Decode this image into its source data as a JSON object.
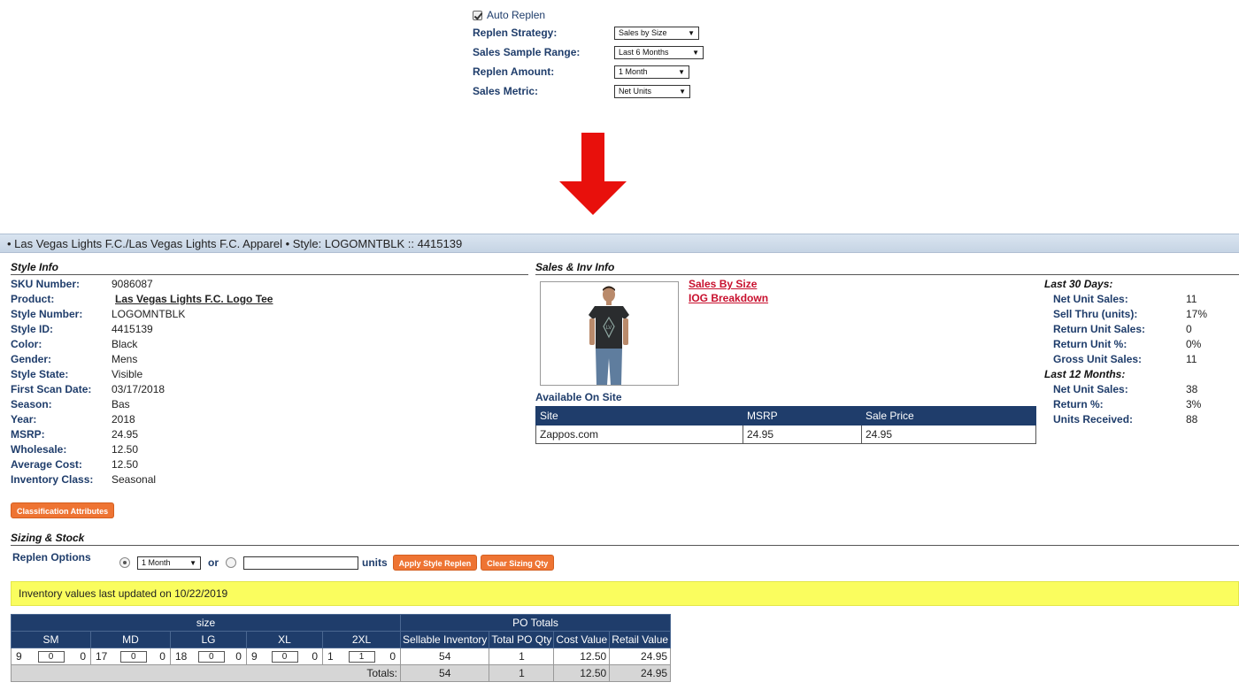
{
  "settings": {
    "auto_replen_label": "Auto Replen",
    "rows": [
      {
        "label": "Replen Strategy:",
        "value": "Sales by Size"
      },
      {
        "label": "Sales Sample Range:",
        "value": "Last 6 Months"
      },
      {
        "label": "Replen Amount:",
        "value": "1 Month"
      },
      {
        "label": "Sales Metric:",
        "value": "Net Units"
      }
    ]
  },
  "header": {
    "title": "• Las Vegas Lights F.C./Las Vegas Lights F.C. Apparel • Style: LOGOMNTBLK :: 4415139"
  },
  "style_info": {
    "title": "Style Info",
    "rows": [
      {
        "label": "SKU Number:",
        "value": "9086087"
      },
      {
        "label": "Product:",
        "value": "Las Vegas Lights F.C. Logo Tee"
      },
      {
        "label": "Style Number:",
        "value": "LOGOMNTBLK"
      },
      {
        "label": "Style ID:",
        "value": "4415139"
      },
      {
        "label": "Color:",
        "value": "Black"
      },
      {
        "label": "Gender:",
        "value": "Mens"
      },
      {
        "label": "Style State:",
        "value": "Visible"
      },
      {
        "label": "First Scan Date:",
        "value": "03/17/2018"
      },
      {
        "label": "Season:",
        "value": "Bas"
      },
      {
        "label": "Year:",
        "value": "2018"
      },
      {
        "label": "MSRP:",
        "value": "24.95"
      },
      {
        "label": "Wholesale:",
        "value": "12.50"
      },
      {
        "label": "Average Cost:",
        "value": "12.50"
      },
      {
        "label": "Inventory Class:",
        "value": "Seasonal"
      }
    ],
    "classification_button": "Classification Attributes"
  },
  "sales_info": {
    "title": "Sales & Inv Info",
    "links": [
      "Sales By Size",
      "IOG Breakdown"
    ],
    "available_label": "Available On Site",
    "site_table": {
      "headers": [
        "Site",
        "MSRP",
        "Sale Price"
      ],
      "rows": [
        [
          "Zappos.com",
          "24.95",
          "24.95"
        ]
      ]
    },
    "last30_label": "Last 30 Days:",
    "last30": [
      {
        "label": "Net Unit Sales:",
        "value": "11"
      },
      {
        "label": "Sell Thru (units):",
        "value": "17%"
      },
      {
        "label": "Return Unit Sales:",
        "value": "0"
      },
      {
        "label": "Return Unit %:",
        "value": "0%"
      },
      {
        "label": "Gross Unit Sales:",
        "value": "11"
      }
    ],
    "last12_label": "Last 12 Months:",
    "last12": [
      {
        "label": "Net Unit Sales:",
        "value": "38"
      },
      {
        "label": "Return %:",
        "value": "3%"
      },
      {
        "label": "Units Received:",
        "value": "88"
      }
    ]
  },
  "sizing": {
    "title": "Sizing & Stock",
    "replen_label": "Replen Options",
    "replen_select": "1 Month",
    "or_label": "or",
    "units_input": "",
    "units_label": "units",
    "apply_button": "Apply Style Replen",
    "clear_button": "Clear Sizing Qty",
    "banner": "Inventory values last updated on 10/22/2019",
    "size_group": "size",
    "po_group": "PO Totals",
    "sizes": [
      {
        "name": "SM",
        "left": "9",
        "input": "0",
        "right": "0"
      },
      {
        "name": "MD",
        "left": "17",
        "input": "0",
        "right": "0"
      },
      {
        "name": "LG",
        "left": "18",
        "input": "0",
        "right": "0"
      },
      {
        "name": "XL",
        "left": "9",
        "input": "0",
        "right": "0"
      },
      {
        "name": "2XL",
        "left": "1",
        "input": "1",
        "right": "0"
      }
    ],
    "po_headers": [
      "Sellable Inventory",
      "Total PO Qty",
      "Cost Value",
      "Retail Value"
    ],
    "po_row": [
      "54",
      "1",
      "12.50",
      "24.95"
    ],
    "totals_label": "Totals:",
    "totals_row": [
      "54",
      "1",
      "12.50",
      "24.95"
    ]
  },
  "colors": {
    "accent_navy": "#1f3d6b",
    "link_red": "#c8102e",
    "button_orange": "#ee7433",
    "banner_yellow": "#fafd5e",
    "arrow_red": "#e8100c"
  }
}
